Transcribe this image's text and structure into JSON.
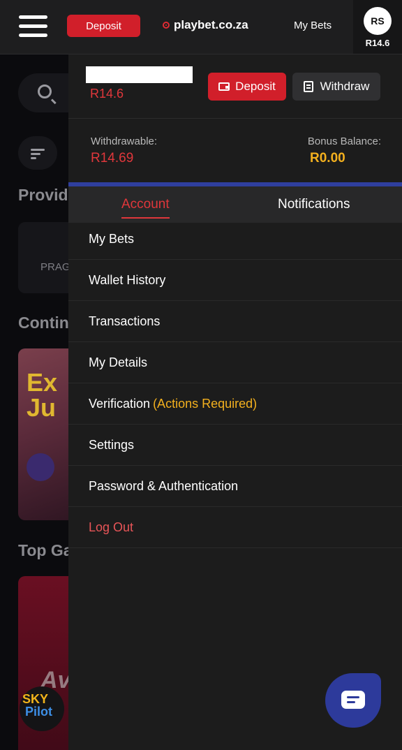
{
  "header": {
    "deposit_label": "Deposit",
    "logo_text": "playbet.co.za",
    "my_bets_label": "My Bets",
    "avatar_initials": "RS",
    "balance": "R14.6"
  },
  "background": {
    "heading_providers": "Provid",
    "provider_card": "PRAG",
    "heading_continue": "Contin",
    "tile_text_1": "Ex",
    "tile_text_2": "Ju",
    "heading_top": "Top Ga",
    "tile2_text": "Av",
    "sky_top": "SKY",
    "sky_bottom": "Pilot"
  },
  "drawer": {
    "balance": "R14.6",
    "deposit_label": "Deposit",
    "withdraw_label": "Withdraw",
    "withdrawable_label": "Withdrawable:",
    "withdrawable_value": "R14.69",
    "bonus_label": "Bonus Balance:",
    "bonus_value": "R0.00",
    "tabs": [
      "Account",
      "Notifications"
    ],
    "menu": [
      {
        "label": "My Bets"
      },
      {
        "label": "Wallet History"
      },
      {
        "label": "Transactions"
      },
      {
        "label": "My Details"
      },
      {
        "label": "Verification",
        "note": "(Actions Required)"
      },
      {
        "label": "Settings"
      },
      {
        "label": "Password & Authentication"
      },
      {
        "label": "Log Out"
      }
    ]
  },
  "colors": {
    "accent_red": "#d11f2a",
    "warning_yellow": "#f3b01e",
    "tab_border_blue": "#2f3f9e",
    "chat_blue": "#2d3a9b"
  },
  "icons": [
    "hamburger-menu-icon",
    "search-icon",
    "filter-icon",
    "wallet-icon",
    "atm-icon",
    "chat-icon"
  ]
}
